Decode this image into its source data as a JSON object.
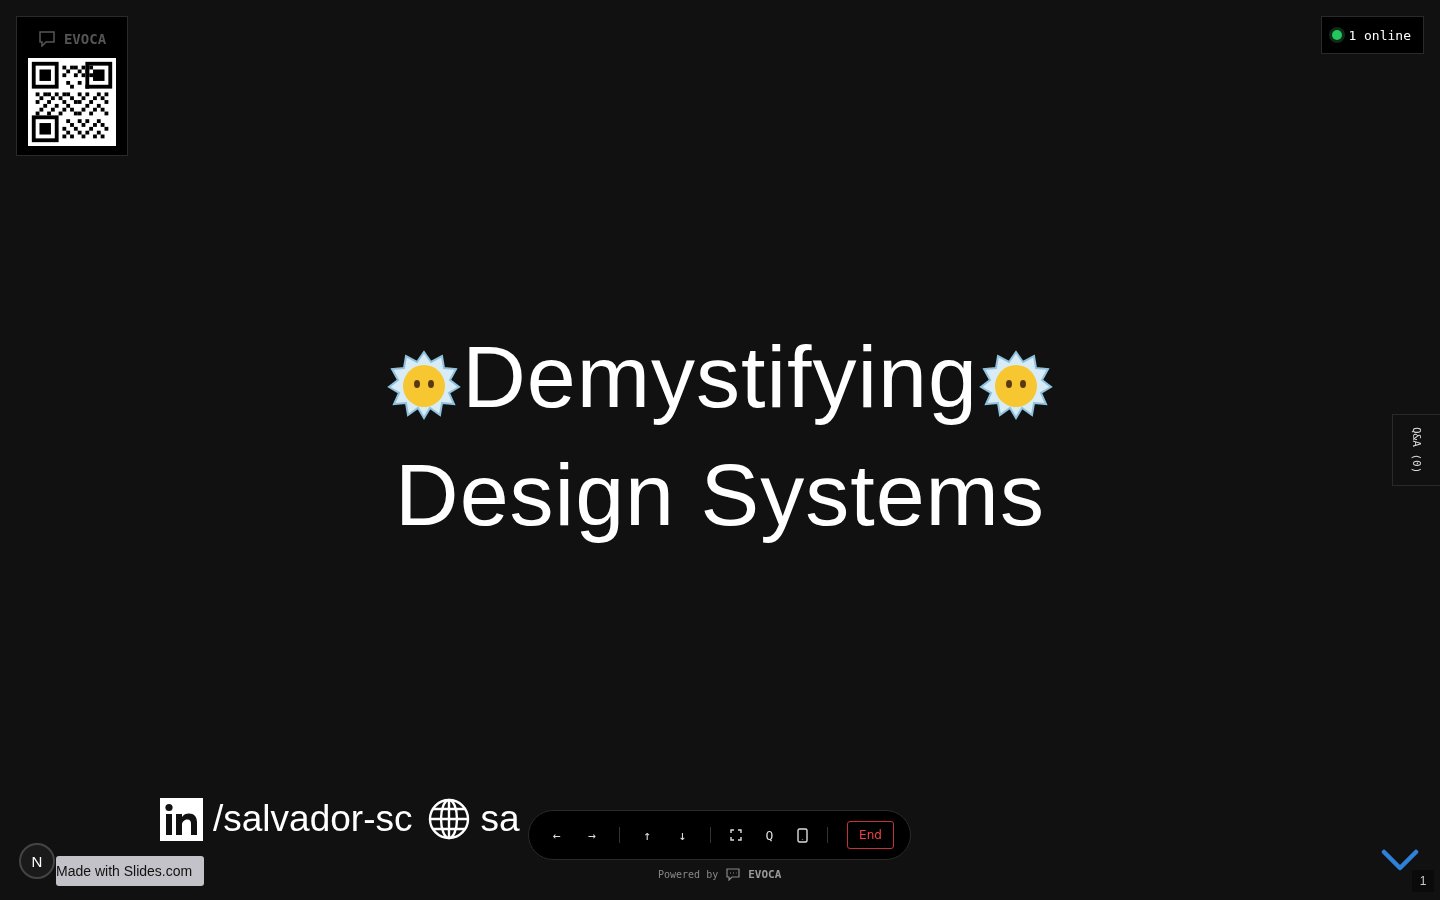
{
  "qr_panel": {
    "brand": "EVOCA"
  },
  "presence": {
    "label": "1 online"
  },
  "slide": {
    "title_lines": [
      "Demystifying",
      "Design Systems"
    ],
    "links": [
      {
        "kind": "linkedin",
        "text": "/salvador-sc"
      },
      {
        "kind": "website",
        "text": "sa"
      }
    ]
  },
  "qa_tab": {
    "label": "Q&A (0)"
  },
  "toolbar": {
    "buttons": [
      {
        "kind": "text",
        "label": "←"
      },
      {
        "kind": "text",
        "label": "→"
      },
      {
        "kind": "divider"
      },
      {
        "kind": "text",
        "label": "↑"
      },
      {
        "kind": "text",
        "label": "↓"
      },
      {
        "kind": "divider"
      },
      {
        "kind": "fullscreen"
      },
      {
        "kind": "text",
        "label": "Q"
      },
      {
        "kind": "phone"
      },
      {
        "kind": "divider"
      },
      {
        "kind": "end",
        "label": "End"
      }
    ]
  },
  "powered_by": {
    "prefix": "Powered by",
    "brand": "EVOCA"
  },
  "made_with": {
    "badge": "N",
    "label": "Made with Slides.com"
  },
  "slide_number": "1"
}
